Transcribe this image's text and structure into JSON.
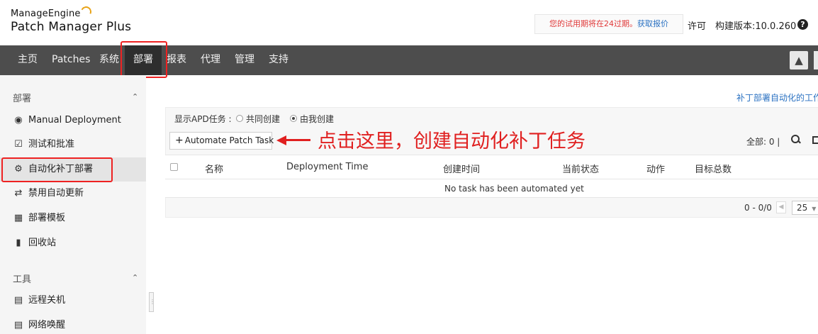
{
  "header": {
    "brand": "ManageEngine",
    "product": "Patch Manager Plus",
    "trial_text": "您的试用期将在24过期。",
    "trial_link": "获取报价",
    "license": "许可",
    "version": "构建版本:10.0.260",
    "help_label": "?"
  },
  "nav": {
    "items": [
      "主页",
      "Patches",
      "系统",
      "部署",
      "报表",
      "代理",
      "管理",
      "支持"
    ],
    "active": "部署"
  },
  "sidebar": {
    "section1": "部署",
    "items1": [
      "Manual Deployment",
      "测试和批准",
      "自动化补丁部署",
      "禁用自动更新",
      "部署模板",
      "回收站"
    ],
    "section2": "工具",
    "items2": [
      "远程关机",
      "网络唤醒"
    ]
  },
  "main": {
    "top_link": "补丁部署自动化的工作",
    "apd_label": "显示APD任务 :",
    "radio1": "共同创建",
    "radio2": "由我创建",
    "button_label": "Automate Patch Task",
    "annotation": "点击这里，创建自动化补丁任务",
    "total": "全部: 0  |",
    "columns": [
      "名称",
      "Deployment Time",
      "创建时间",
      "当前状态",
      "动作",
      "目标总数"
    ],
    "empty": "No task has been automated yet",
    "pager": "0 - 0/0",
    "page_size": "25"
  },
  "colors": {
    "nav_bg": "#4d4d4d",
    "nav_active": "#2e2e2e",
    "annotation_red": "#e02020",
    "link_blue": "#2b72c2"
  }
}
